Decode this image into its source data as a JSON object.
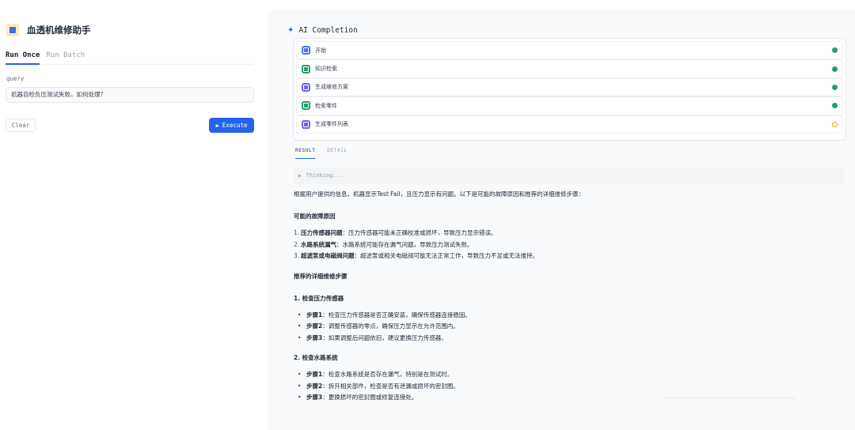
{
  "app": {
    "title": "血透机维修助手"
  },
  "left_tabs": [
    {
      "label": "Run Once"
    },
    {
      "label": "Run Batch"
    }
  ],
  "query": {
    "label": "query",
    "value": "机器自检负压测试失败，如何处理?"
  },
  "buttons": {
    "clear": "Clear",
    "execute": "Execute"
  },
  "completion": {
    "title": "AI Completion",
    "steps": [
      {
        "label": "开始",
        "status": "done",
        "icon_color": "#4f6df5"
      },
      {
        "label": "知识检索",
        "status": "done",
        "icon_color": "#22a06b"
      },
      {
        "label": "生成维修方案",
        "status": "done",
        "icon_color": "#6e62f0"
      },
      {
        "label": "检索零件",
        "status": "done",
        "icon_color": "#22a06b"
      },
      {
        "label": "生成零件列表",
        "status": "running",
        "icon_color": "#6e62f0"
      }
    ]
  },
  "result_tabs": [
    {
      "label": "RESULT"
    },
    {
      "label": "DETAIL"
    }
  ],
  "thinking": "Thinking...",
  "result": {
    "intro": "根据用户提供的信息，机器显示Test Fail，且压力显示有问题。以下是可能的故障原因和推荐的详细维修步骤：",
    "causes_heading": "可能的故障原因",
    "causes": [
      {
        "num": "1.",
        "title": "压力传感器问题",
        "text": "：压力传感器可能未正确校准或损坏，导致压力显示错误。"
      },
      {
        "num": "2.",
        "title": "水路系统漏气",
        "text": "：水路系统可能存在漏气问题，导致压力测试失败。"
      },
      {
        "num": "3.",
        "title": "超滤泵或电磁阀问题",
        "text": "：超滤泵或相关电磁阀可能无法正常工作，导致压力不足或无法维持。"
      }
    ],
    "steps_heading": "推荐的详细维修步骤",
    "sections": [
      {
        "heading": "1.  检查压力传感器",
        "items": [
          {
            "title": "步骤1",
            "text": "：检查压力传感器是否正确安装，确保传感器连接稳固。"
          },
          {
            "title": "步骤2",
            "text": "：调整传感器的零点，确保压力显示在允许范围内。"
          },
          {
            "title": "步骤3",
            "text": "：如果调整后问题依旧，建议更换压力传感器。"
          }
        ]
      },
      {
        "heading": "2.  检查水路系统",
        "items": [
          {
            "title": "步骤1",
            "text": "：检查水路系统是否存在漏气，特别是在测试时。"
          },
          {
            "title": "步骤2",
            "text": "：拆开相关部件，检查是否有泄漏或损坏的密封圈。"
          },
          {
            "title": "步骤3",
            "text": "：更换损坏的密封圈或修复连接处。"
          }
        ]
      }
    ]
  }
}
